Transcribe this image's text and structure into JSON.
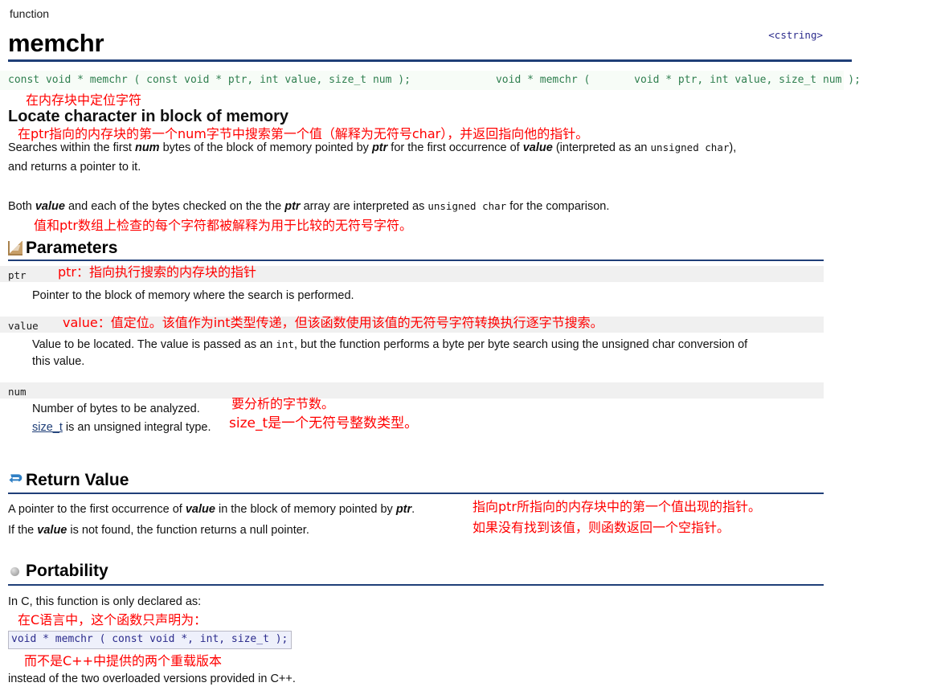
{
  "header": {
    "kind": "function",
    "title": "memchr",
    "include": "<cstring>"
  },
  "syntax": {
    "signature_const": "const void * memchr ( const void * ptr, int value, size_t num );",
    "signature_nonconst": "      void * memchr (       void * ptr, int value, size_t num );"
  },
  "summary": {
    "heading_cn": "在内存块中定位字符",
    "heading_en": "Locate character in block of memory",
    "desc_cn": "在ptr指向的内存块的第一个num字节中搜索第一个值（解释为无符号char），并返回指向他的指针。",
    "desc_en_line1_a": "Searches within the first ",
    "desc_en_line1_num": "num",
    "desc_en_line1_b": " bytes of the block of memory pointed by ",
    "desc_en_line1_ptr": "ptr",
    "desc_en_line1_c": " for the first occurrence of ",
    "desc_en_line1_value": "value",
    "desc_en_line1_d": " (interpreted as an ",
    "desc_en_line1_mono": "unsigned char",
    "desc_en_line1_e": "),",
    "desc_en_line2": "and returns a pointer to it.",
    "both_a": "Both ",
    "both_value": "value",
    "both_b": " and each of the bytes checked on the the ",
    "both_ptr": "ptr",
    "both_c": " array are interpreted as ",
    "both_mono": "unsigned char",
    "both_d": " for the comparison.",
    "both_cn": "值和ptr数组上检查的每个字符都被解释为用于比较的无符号字符。"
  },
  "parameters": {
    "section_title": "Parameters",
    "icon": "ruler-icon",
    "items": [
      {
        "name": "ptr",
        "note_cn": "ptr：指向执行搜索的内存块的指针",
        "desc": "Pointer to the block of memory where the search is performed."
      },
      {
        "name": "value",
        "note_cn": "value：值定位。该值作为int类型传递，但该函数使用该值的无符号字符转换执行逐字节搜索。",
        "desc_a": "Value to be located. The value is passed as an ",
        "desc_mono1": "int",
        "desc_b": ", but the function performs a byte per byte search using the ",
        "desc_bi": "unsigned char",
        "desc_c": " conversion of",
        "desc_line2": "this value."
      },
      {
        "name": "num",
        "note_cn": "",
        "desc_line1": "Number of bytes to be analyzed.",
        "desc_line1_cn": "要分析的字节数。",
        "desc_line2_link": "size_t",
        "desc_line2_rest": " is an unsigned integral type.",
        "desc_line2_cn": "size_t是一个无符号整数类型。"
      }
    ]
  },
  "return_value": {
    "section_title": "Return Value",
    "icon": "return-arrow-icon",
    "line1_a": "A pointer to the first occurrence of ",
    "line1_value": "value",
    "line1_b": " in the block of memory pointed by ",
    "line1_ptr": "ptr",
    "line1_c": ".",
    "line2_a": "If the ",
    "line2_value": "value",
    "line2_b": " is not found, the function returns a null pointer.",
    "line1_cn": "指向ptr所指向的内存块中的第一个值出现的指针。",
    "line2_cn": "如果没有找到该值，则函数返回一个空指针。"
  },
  "portability": {
    "section_title": "Portability",
    "icon": "sphere-bullet-icon",
    "intro_en": "In C, this function is only declared as:",
    "intro_cn": "在C语言中，这个函数只声明为：",
    "code": "void * memchr ( const void *, int, size_t );",
    "outro_cn": "而不是C++中提供的两个重载版本",
    "outro_en": "instead of the two overloaded versions provided in C++."
  },
  "colors": {
    "rule_blue": "#1f3f78",
    "annotation_red": "#ff0000",
    "syntax_green": "#2f7f4f",
    "code_blue": "#2b2b8c",
    "param_band_gray": "#f0f0f0"
  }
}
